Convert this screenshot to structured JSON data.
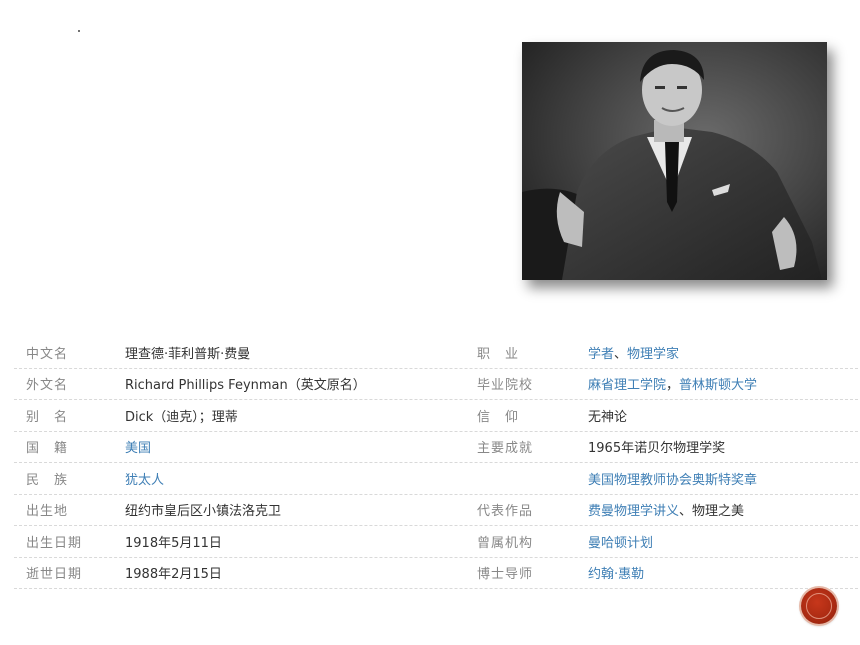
{
  "photo": {
    "alt": "black-and-white portrait photo"
  },
  "rows": [
    {
      "l1": "中文名",
      "v1": "理查德·菲利普斯·费曼",
      "l2": "职　业",
      "v2a": "学者",
      "v2sep": "、",
      "v2b": "物理学家",
      "v2c": ""
    },
    {
      "l1": "外文名",
      "v1": "Richard Phillips Feynman（英文原名）",
      "l2": "毕业院校",
      "v2a": "麻省理工学院",
      "v2sep": "，",
      "v2b": "普林斯顿大学",
      "v2c": ""
    },
    {
      "l1": "别　名",
      "v1": "Dick（迪克）；理蒂",
      "l2": "信　仰",
      "v2a": "",
      "v2sep": "",
      "v2b": "",
      "v2c": "无神论"
    },
    {
      "l1": "国　籍",
      "v1": "美国",
      "l2": "主要成就",
      "v2a": "",
      "v2sep": "",
      "v2b": "",
      "v2c": "1965年诺贝尔物理学奖"
    },
    {
      "l1": "民　族",
      "v1": "犹太人",
      "l2": "",
      "v2a": "美国物理教师协会奥斯特奖章",
      "v2sep": "",
      "v2b": "",
      "v2c": ""
    },
    {
      "l1": "出生地",
      "v1": "纽约市皇后区小镇法洛克卫",
      "l2": "代表作品",
      "v2a": "费曼物理学讲义",
      "v2sep": "、",
      "v2b": "",
      "v2c": "物理之美"
    },
    {
      "l1": "出生日期",
      "v1": "1918年5月11日",
      "l2": "曾属机构",
      "v2a": "曼哈顿计划",
      "v2sep": "",
      "v2b": "",
      "v2c": ""
    },
    {
      "l1": "逝世日期",
      "v1": "1988年2月15日",
      "l2": "博士导师",
      "v2a": "约翰·惠勒",
      "v2sep": "",
      "v2b": "",
      "v2c": ""
    }
  ],
  "colors": {
    "link": "#3f7fb5",
    "label": "#888888",
    "accent": "#a92a12"
  }
}
